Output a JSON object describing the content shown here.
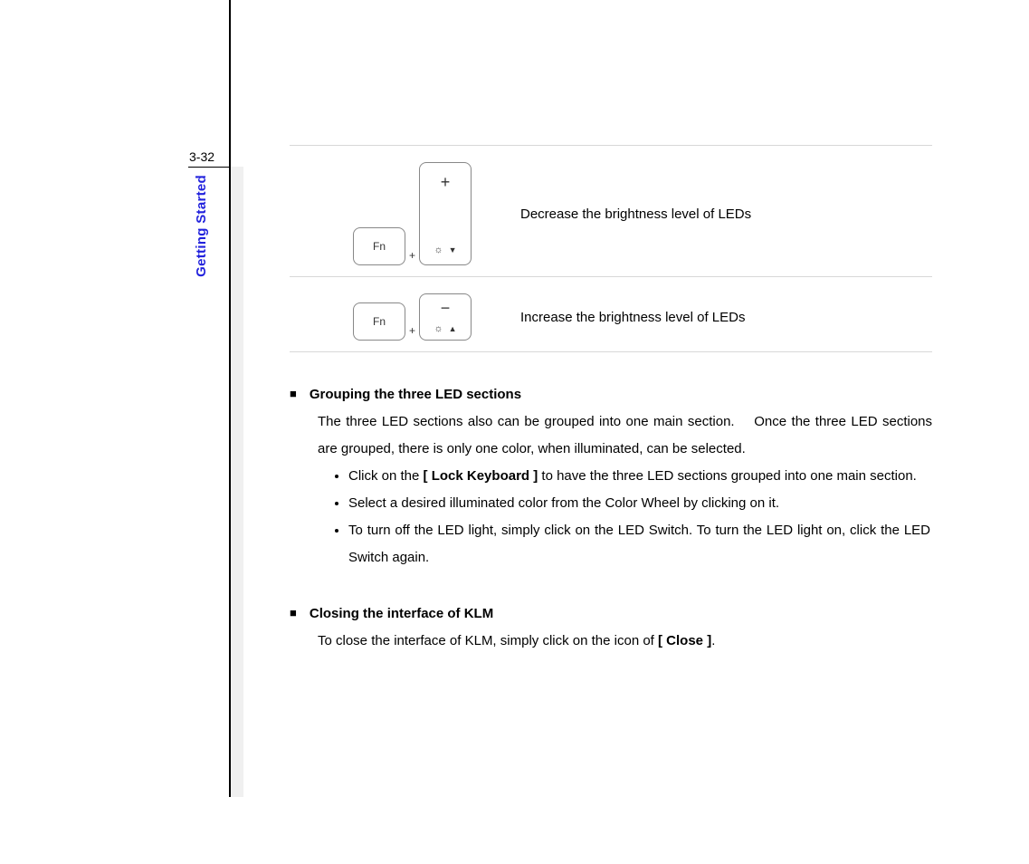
{
  "page_number": "3-32",
  "section_tab": "Getting Started",
  "keys": {
    "fn_label": "Fn",
    "plus_symbol": "+",
    "minus_symbol": "−"
  },
  "keyrows": [
    {
      "modifier_top": "+",
      "arrow": "▼",
      "description": "Decrease the brightness level of LEDs"
    },
    {
      "modifier_top": "−",
      "arrow": "▲",
      "description": "Increase the brightness level of LEDs"
    }
  ],
  "grouping": {
    "title": "Grouping the three LED sections",
    "intro_a": "The three LED sections also can be grouped into one main section.",
    "intro_b": "Once the three LED sections are grouped, there is only one color, when illuminated, can be selected.",
    "bullets": [
      {
        "pre": "Click on the ",
        "bold": "[ Lock Keyboard ]",
        "post": " to have the three LED sections grouped into one main section."
      },
      {
        "pre": "Select a desired illuminated color from the Color Wheel by clicking on it.",
        "bold": "",
        "post": ""
      },
      {
        "pre": "To turn off the LED light, simply click on the LED Switch.",
        "bold": "",
        "post": "   To turn the LED light on, click the LED Switch again."
      }
    ]
  },
  "closing": {
    "title": "Closing the interface of KLM",
    "line_pre": "To close the interface of KLM, simply click on the icon of ",
    "line_bold": "[ Close ]",
    "line_post": "."
  }
}
